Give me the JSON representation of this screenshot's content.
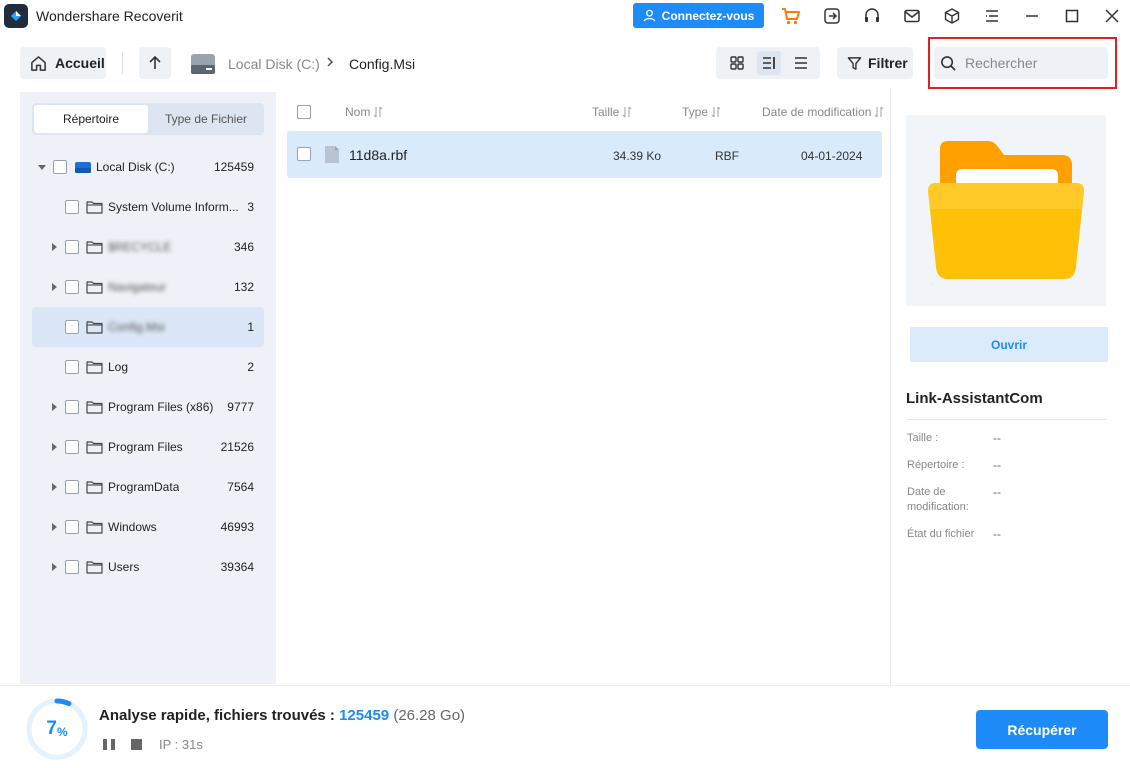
{
  "app": {
    "title": "Wondershare Recoverit",
    "connect_label": "Connectez-vous"
  },
  "toolbar": {
    "home_label": "Accueil",
    "breadcrumb": [
      "Local Disk (C:)",
      "Config.Msi"
    ],
    "filter_label": "Filtrer",
    "search_placeholder": "Rechercher",
    "active_view": "details-view"
  },
  "sidebar": {
    "tabs": [
      "Répertoire",
      "Type de Fichier"
    ],
    "active_tab": "Répertoire",
    "tree": [
      {
        "label": "Local Disk (C:)",
        "count": "125459",
        "level": 0,
        "expanded": true,
        "type": "drive"
      },
      {
        "label": "System Volume Inform...",
        "count": "3",
        "level": 1,
        "expandable": false
      },
      {
        "label": "$RECYCLE",
        "count": "346",
        "level": 1,
        "expandable": true,
        "blurred": true
      },
      {
        "label": "Navigateur",
        "count": "132",
        "level": 1,
        "expandable": true,
        "blurred": true
      },
      {
        "label": "Config.Msi",
        "count": "1",
        "level": 1,
        "expandable": false,
        "blurred": true,
        "selected": true
      },
      {
        "label": "Log",
        "count": "2",
        "level": 1,
        "expandable": false
      },
      {
        "label": "Program Files (x86)",
        "count": "9777",
        "level": 1,
        "expandable": true
      },
      {
        "label": "Program Files",
        "count": "21526",
        "level": 1,
        "expandable": true
      },
      {
        "label": "ProgramData",
        "count": "7564",
        "level": 1,
        "expandable": true
      },
      {
        "label": "Windows",
        "count": "46993",
        "level": 1,
        "expandable": true
      },
      {
        "label": "Users",
        "count": "39364",
        "level": 1,
        "expandable": true
      }
    ]
  },
  "file_list": {
    "columns": [
      "Nom",
      "Taille",
      "Type",
      "Date de modification"
    ],
    "rows": [
      {
        "name": "11d8a.rbf",
        "size": "34.39 Ko",
        "type": "RBF",
        "date": "04-01-2024"
      }
    ]
  },
  "preview": {
    "open_label": "Ouvrir",
    "name": "Link-AssistantCom",
    "meta": [
      {
        "label": "Taille :",
        "value": "--"
      },
      {
        "label": "Répertoire :",
        "value": "--"
      },
      {
        "label": "Date de modification:",
        "value": "--"
      },
      {
        "label": "État du fichier",
        "value": "--"
      }
    ]
  },
  "status": {
    "progress_value": "7",
    "progress_unit": "%",
    "progress_fraction": 0.07,
    "scan_label": "Analyse rapide, fichiers trouvés :",
    "found_count": "125459",
    "found_size": "(26.28 Go)",
    "elapsed": "IP : 31s",
    "recover_label": "Récupérer"
  },
  "colors": {
    "accent": "#1d8cf8",
    "sidebar_bg": "#eef2f8",
    "selected_row": "#d9eafb",
    "highlight_border": "#e02020",
    "cart": "#ff7a00",
    "folder": "#ffb300"
  },
  "icons": [
    "recoverit-logo-icon",
    "user-icon",
    "cart-icon",
    "export-icon",
    "headset-icon",
    "mail-icon",
    "box-icon",
    "menu-icon",
    "minimize-icon",
    "maximize-icon",
    "close-icon",
    "home-icon",
    "arrow-up-icon",
    "drive-icon",
    "chevron-right-icon",
    "grid-view-icon",
    "details-view-icon",
    "list-view-icon",
    "filter-icon",
    "search-icon",
    "folder-icon",
    "file-icon",
    "sort-icon",
    "pause-icon",
    "stop-icon"
  ]
}
